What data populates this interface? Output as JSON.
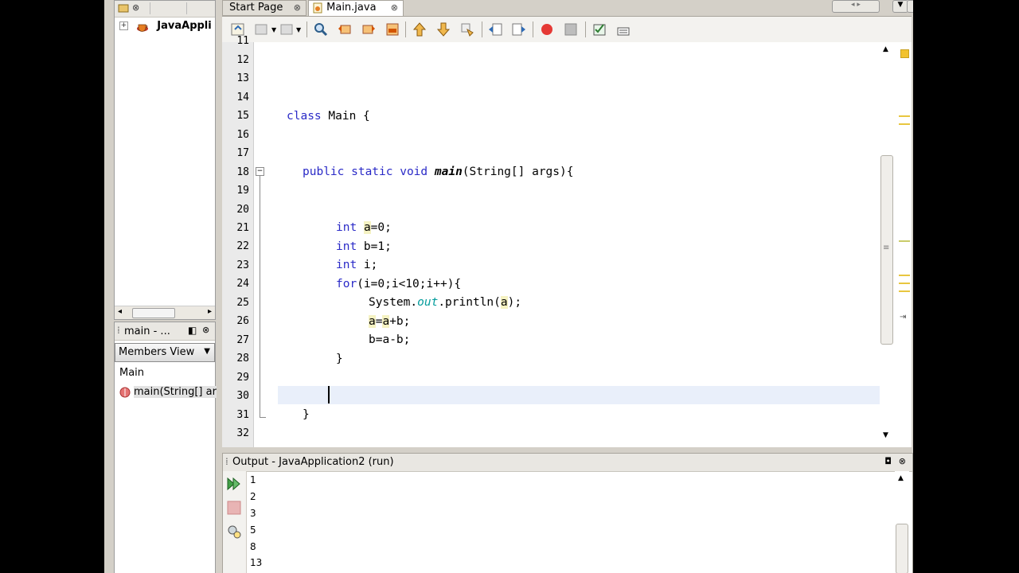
{
  "projects": {
    "tab_close": "⊗",
    "project_name": "JavaAppli",
    "expander": "+"
  },
  "navigator": {
    "title": "main - ...",
    "view_combo": "Members View",
    "class_node": "Main",
    "method_node": "main(String[] ar"
  },
  "editor": {
    "tabs": [
      {
        "label": "Start Page",
        "close": "⊗"
      },
      {
        "label": "Main.java",
        "close": "⊗"
      }
    ],
    "line_numbers": [
      "11",
      "12",
      "13",
      "14",
      "15",
      "16",
      "17",
      "18",
      "19",
      "20",
      "21",
      "22",
      "23",
      "24",
      "25",
      "26",
      "27",
      "28",
      "29",
      "30",
      "31",
      "32"
    ],
    "code": {
      "l15_kw": "class",
      "l15_rest": " Main {",
      "l18_kw": "public static void",
      "l18_fn": "main",
      "l18_rest": "(String[] args){",
      "l21_kw": "int",
      "l21_var": "a",
      "l21_rest": "=0;",
      "l22_kw": "int",
      "l22_rest": " b=1;",
      "l23_kw": "int",
      "l23_rest": " i;",
      "l24_kw": "for",
      "l24_rest": "(i=0;i<10;i++){",
      "l25_pre": "System.",
      "l25_fld": "out",
      "l25_mid": ".println(",
      "l25_var": "a",
      "l25_post": ");",
      "l26_v1": "a",
      "l26_eq": "=",
      "l26_v2": "a",
      "l26_rest": "+b;",
      "l27": "b=a-b;",
      "l28": "}",
      "l31": "}"
    }
  },
  "output": {
    "title": "Output - JavaApplication2 (run)",
    "lines": [
      "1",
      "2",
      "3",
      "5",
      "8",
      "13"
    ]
  },
  "colors": {
    "keyword": "#2a2ac7",
    "field": "#049c9c",
    "occurrence_highlight": "#f5f2c2",
    "current_line": "#e9effa",
    "marker": "#e8c63f"
  }
}
